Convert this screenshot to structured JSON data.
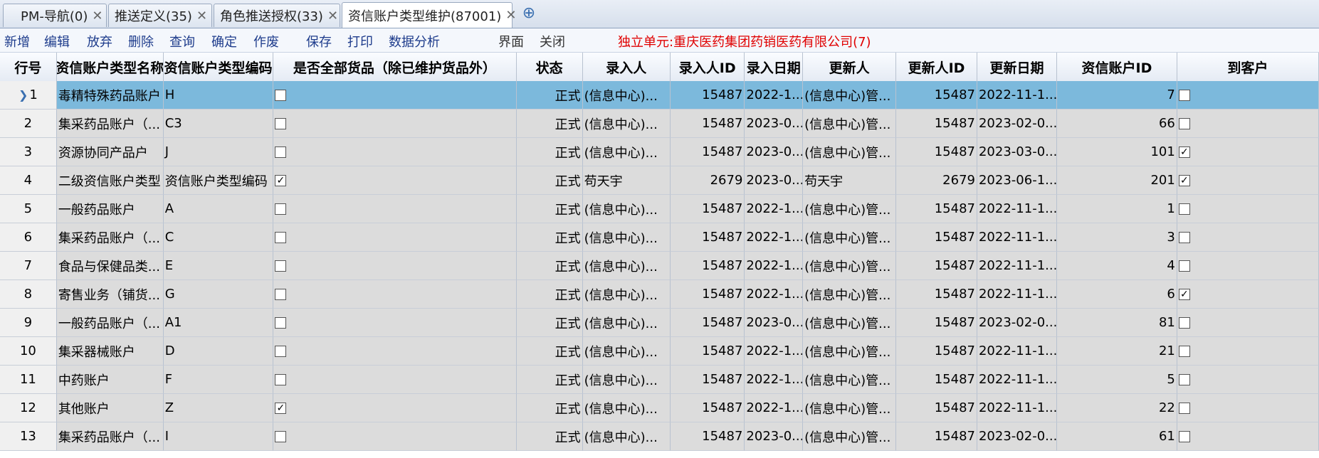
{
  "tabs": [
    {
      "label": "PM-导航(0)",
      "active": false
    },
    {
      "label": "推送定义(35)",
      "active": false
    },
    {
      "label": "角色推送授权(33)",
      "active": false
    },
    {
      "label": "资信账户类型维护(87001)",
      "active": true
    }
  ],
  "toolbar": {
    "buttons": [
      "新增",
      "编辑",
      "放弃",
      "删除",
      "查询",
      "确定",
      "作废",
      "保存",
      "打印",
      "数据分析",
      "界面",
      "关闭"
    ],
    "unit_text": "独立单元:重庆医药集团药销医药有限公司(7)"
  },
  "table": {
    "headers": [
      "行号",
      "资信账户类型名称",
      "资信账户类型编码",
      "是否全部货品（除已维护货品外）",
      "状态",
      "录入人",
      "录入人ID",
      "录入日期",
      "更新人",
      "更新人ID",
      "更新日期",
      "资信账户ID",
      "到客户"
    ],
    "rows": [
      {
        "no": "1",
        "name": "毒精特殊药品账户",
        "code": "H",
        "all": false,
        "status": "正式",
        "creator": "(信息中心)...",
        "creator_id": "15487",
        "created": "2022-1...",
        "updater": "(信息中心)管...",
        "updater_id": "15487",
        "updated": "2022-11-1...",
        "account_id": "7",
        "to_customer": false,
        "selected": true
      },
      {
        "no": "2",
        "name": "集采药品账户（...",
        "code": "C3",
        "all": false,
        "status": "正式",
        "creator": "(信息中心)...",
        "creator_id": "15487",
        "created": "2023-0...",
        "updater": "(信息中心)管...",
        "updater_id": "15487",
        "updated": "2023-02-0...",
        "account_id": "66",
        "to_customer": false
      },
      {
        "no": "3",
        "name": "资源协同产品户",
        "code": "J",
        "all": false,
        "status": "正式",
        "creator": "(信息中心)...",
        "creator_id": "15487",
        "created": "2023-0...",
        "updater": "(信息中心)管...",
        "updater_id": "15487",
        "updated": "2023-03-0...",
        "account_id": "101",
        "to_customer": true
      },
      {
        "no": "4",
        "name": "二级资信账户类型",
        "code": "资信账户类型编码",
        "all": true,
        "status": "正式",
        "creator": "苟天宇",
        "creator_id": "2679",
        "created": "2023-0...",
        "updater": "苟天宇",
        "updater_id": "2679",
        "updated": "2023-06-1...",
        "account_id": "201",
        "to_customer": true
      },
      {
        "no": "5",
        "name": "一般药品账户",
        "code": "A",
        "all": false,
        "status": "正式",
        "creator": "(信息中心)...",
        "creator_id": "15487",
        "created": "2022-1...",
        "updater": "(信息中心)管...",
        "updater_id": "15487",
        "updated": "2022-11-1...",
        "account_id": "1",
        "to_customer": false
      },
      {
        "no": "6",
        "name": "集采药品账户（...",
        "code": "C",
        "all": false,
        "status": "正式",
        "creator": "(信息中心)...",
        "creator_id": "15487",
        "created": "2022-1...",
        "updater": "(信息中心)管...",
        "updater_id": "15487",
        "updated": "2022-11-1...",
        "account_id": "3",
        "to_customer": false
      },
      {
        "no": "7",
        "name": "食品与保健品类...",
        "code": "E",
        "all": false,
        "status": "正式",
        "creator": "(信息中心)...",
        "creator_id": "15487",
        "created": "2022-1...",
        "updater": "(信息中心)管...",
        "updater_id": "15487",
        "updated": "2022-11-1...",
        "account_id": "4",
        "to_customer": false
      },
      {
        "no": "8",
        "name": "寄售业务（铺货...",
        "code": "G",
        "all": false,
        "status": "正式",
        "creator": "(信息中心)...",
        "creator_id": "15487",
        "created": "2022-1...",
        "updater": "(信息中心)管...",
        "updater_id": "15487",
        "updated": "2022-11-1...",
        "account_id": "6",
        "to_customer": true
      },
      {
        "no": "9",
        "name": "一般药品账户（...",
        "code": "A1",
        "all": false,
        "status": "正式",
        "creator": "(信息中心)...",
        "creator_id": "15487",
        "created": "2023-0...",
        "updater": "(信息中心)管...",
        "updater_id": "15487",
        "updated": "2023-02-0...",
        "account_id": "81",
        "to_customer": false
      },
      {
        "no": "10",
        "name": "集采器械账户",
        "code": "D",
        "all": false,
        "status": "正式",
        "creator": "(信息中心)...",
        "creator_id": "15487",
        "created": "2022-1...",
        "updater": "(信息中心)管...",
        "updater_id": "15487",
        "updated": "2022-11-1...",
        "account_id": "21",
        "to_customer": false
      },
      {
        "no": "11",
        "name": "中药账户",
        "code": "F",
        "all": false,
        "status": "正式",
        "creator": "(信息中心)...",
        "creator_id": "15487",
        "created": "2022-1...",
        "updater": "(信息中心)管...",
        "updater_id": "15487",
        "updated": "2022-11-1...",
        "account_id": "5",
        "to_customer": false
      },
      {
        "no": "12",
        "name": "其他账户",
        "code": "Z",
        "all": true,
        "status": "正式",
        "creator": "(信息中心)...",
        "creator_id": "15487",
        "created": "2022-1...",
        "updater": "(信息中心)管...",
        "updater_id": "15487",
        "updated": "2022-11-1...",
        "account_id": "22",
        "to_customer": false
      },
      {
        "no": "13",
        "name": "集采药品账户（...",
        "code": "I",
        "all": false,
        "status": "正式",
        "creator": "(信息中心)...",
        "creator_id": "15487",
        "created": "2023-0...",
        "updater": "(信息中心)管...",
        "updater_id": "15487",
        "updated": "2023-02-0...",
        "account_id": "61",
        "to_customer": false
      }
    ]
  }
}
